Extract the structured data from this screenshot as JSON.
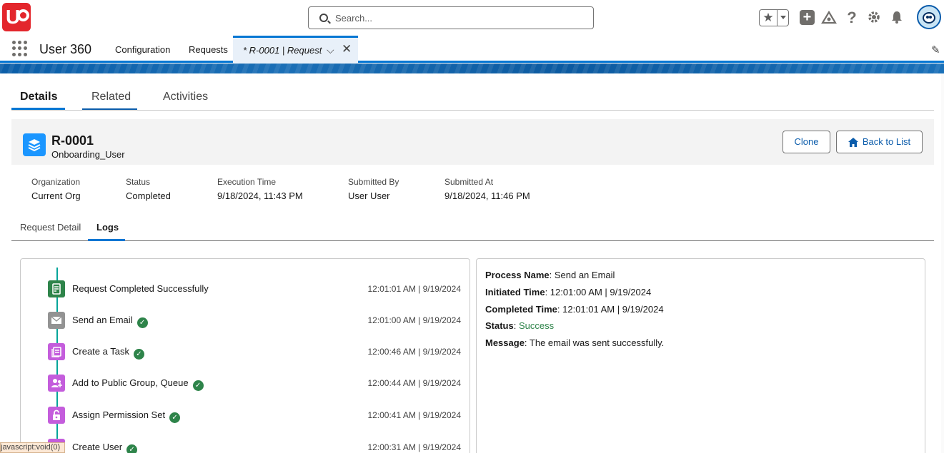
{
  "global_header": {
    "logo_text": "U",
    "search_placeholder": "Search...",
    "icons": [
      "star-icon",
      "chevron-down-icon",
      "plus-icon",
      "trailhead-icon",
      "help-icon",
      "gear-icon",
      "bell-icon",
      "avatar"
    ]
  },
  "nav": {
    "app_name": "User 360",
    "items": [
      "Configuration",
      "Requests"
    ],
    "active_tab": "* R-0001 | Request"
  },
  "top_tabs": [
    "Details",
    "Related",
    "Activities"
  ],
  "record": {
    "title": "R-0001",
    "subtitle": "Onboarding_User",
    "clone_label": "Clone",
    "back_label": "Back to List"
  },
  "fields": [
    {
      "label": "Organization",
      "value": "Current Org"
    },
    {
      "label": "Status",
      "value": "Completed"
    },
    {
      "label": "Execution Time",
      "value": "9/18/2024, 11:43 PM"
    },
    {
      "label": "Submitted By",
      "value": "User User"
    },
    {
      "label": "Submitted At",
      "value": "9/18/2024, 11:46 PM"
    }
  ],
  "sub_tabs": [
    "Request Detail",
    "Logs"
  ],
  "timeline": [
    {
      "label": "Request Completed Successfully",
      "time": "12:01:01 AM | 9/19/2024",
      "icon": "request-completed-icon",
      "color": "#2e844a",
      "check": false
    },
    {
      "label": "Send an Email",
      "time": "12:01:00 AM | 9/19/2024",
      "icon": "email-icon",
      "color": "#939393",
      "check": true
    },
    {
      "label": "Create a Task",
      "time": "12:00:46 AM | 9/19/2024",
      "icon": "task-icon",
      "color": "#c45ddc",
      "check": true
    },
    {
      "label": "Add to Public Group, Queue",
      "time": "12:00:44 AM | 9/19/2024",
      "icon": "group-icon",
      "color": "#c45ddc",
      "check": true
    },
    {
      "label": "Assign Permission Set",
      "time": "12:00:41 AM | 9/19/2024",
      "icon": "permission-lock-icon",
      "color": "#c45ddc",
      "check": true
    },
    {
      "label": "Create User",
      "time": "12:00:31 AM | 9/19/2024",
      "icon": "user-icon",
      "color": "#c45ddc",
      "check": true
    }
  ],
  "detail": {
    "process_name_label": "Process Name",
    "process_name": "Send an Email",
    "initiated_label": "Initiated Time",
    "initiated": "12:01:00 AM | 9/19/2024",
    "completed_label": "Completed Time",
    "completed": "12:01:01 AM | 9/19/2024",
    "status_label": "Status",
    "status": "Success",
    "message_label": "Message",
    "message": "The email was sent successfully."
  },
  "status_tip": "javascript:void(0)"
}
